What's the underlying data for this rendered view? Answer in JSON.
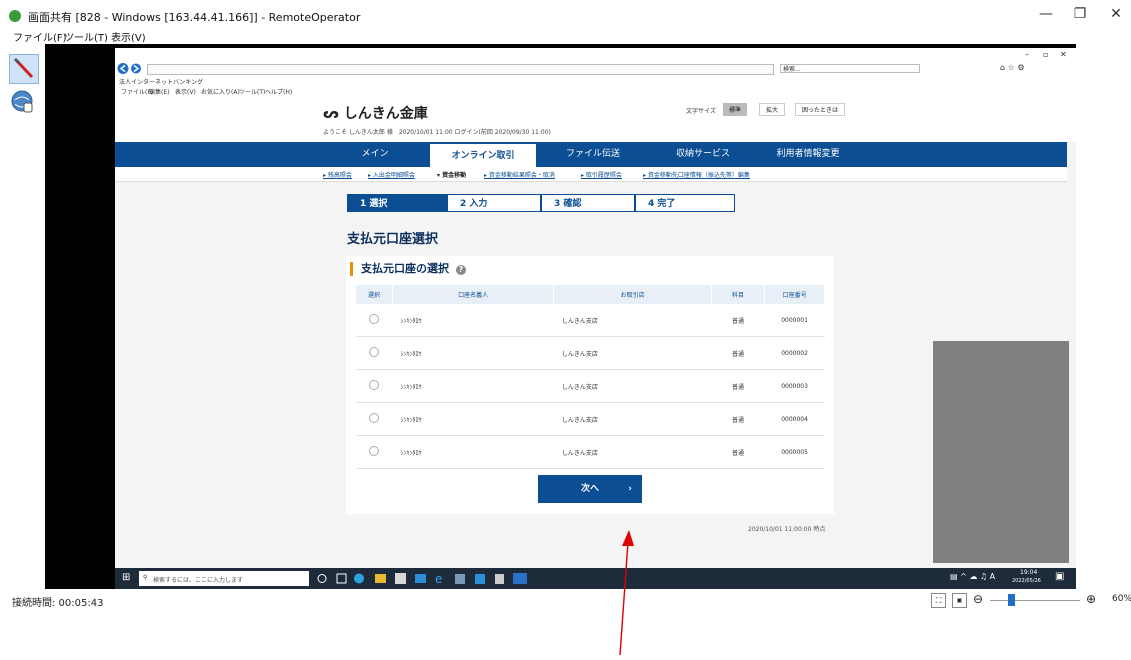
{
  "window": {
    "title": "画面共有 [828 - Windows [163.44.41.166]] - RemoteOperator",
    "minimize": "—",
    "maximize": "❐",
    "close": "✕"
  },
  "menu": [
    "ファイル(F)",
    "ツール(T)",
    "表示(V)"
  ],
  "status": {
    "connection_time": "接続時間: 00:05:43",
    "zoom": "60%"
  },
  "ie": {
    "tab": "法人インターネットバンキング",
    "search_placeholder": "検索...",
    "menu": [
      "ファイル(F)",
      "編集(E)",
      "表示(V)",
      "お気に入り(A)",
      "ツール(T)",
      "ヘルプ(H)"
    ]
  },
  "bank": {
    "logo": "しんきん金庫",
    "font_size_label": "文字サイズ",
    "font_std": "標準",
    "font_large": "拡大",
    "help": "困ったときは",
    "welcome": "ようこそ しんきん太郎 様　2020/10/01 11:00 ログイン(前回 2020/09/30 11:00)",
    "nav": [
      "メイン",
      "オンライン取引",
      "ファイル伝送",
      "収納サービス",
      "利用者情報変更"
    ],
    "subnav": [
      "▸ 残高照会",
      "▸ 入出金明細照会",
      "▾ 資金移動",
      "▸ 資金移動結果照会・取消",
      "▸ 取引履歴照会",
      "▸ 資金移動先口座情報（振込先等）編集"
    ],
    "steps": [
      "1 選択",
      "2 入力",
      "3 確認",
      "4 完了"
    ],
    "page_title": "支払元口座選択",
    "section_title": "支払元口座の選択",
    "columns": [
      "選択",
      "口座名義人",
      "お取引店",
      "科目",
      "口座番号"
    ],
    "rows": [
      {
        "holder": "ｼﾝｷﾝﾀﾛｳ",
        "branch": "しんきん支店",
        "type": "普通",
        "number": "0000001"
      },
      {
        "holder": "ｼﾝｷﾝﾀﾛｳ",
        "branch": "しんきん支店",
        "type": "普通",
        "number": "0000002"
      },
      {
        "holder": "ｼﾝｷﾝﾀﾛｳ",
        "branch": "しんきん支店",
        "type": "普通",
        "number": "0000003"
      },
      {
        "holder": "ｼﾝｷﾝﾀﾛｳ",
        "branch": "しんきん支店",
        "type": "普通",
        "number": "0000004"
      },
      {
        "holder": "ｼﾝｷﾝﾀﾛｳ",
        "branch": "しんきん支店",
        "type": "普通",
        "number": "0000005"
      }
    ],
    "next_label": "次へ",
    "timestamp": "2020/10/01  11:00:00 時点"
  },
  "taskbar": {
    "search_placeholder": "検索するには、ここに入力します",
    "time": "19:04",
    "date": "2022/05/26"
  },
  "colors": {
    "brand": "#0b4e93",
    "accent": "#f08c00",
    "annotation": "#e00000"
  }
}
